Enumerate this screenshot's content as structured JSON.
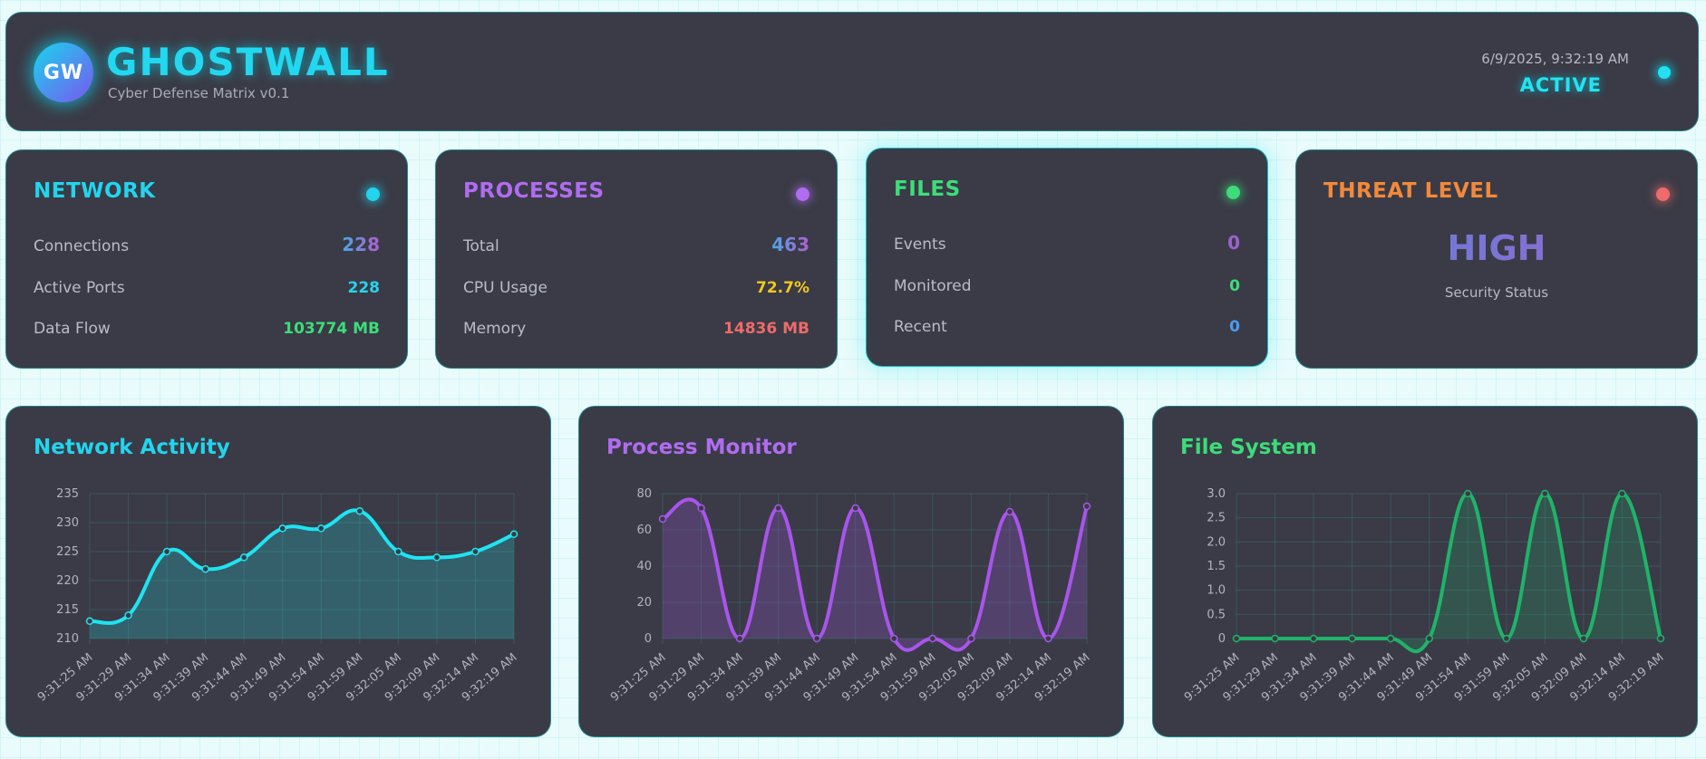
{
  "header": {
    "logo_text": "GW",
    "title": "GHOSTWALL",
    "subtitle": "Cyber Defense Matrix v0.1",
    "datetime": "6/9/2025, 9:32:19 AM",
    "status": "ACTIVE",
    "accent": "#22d8f0"
  },
  "cards": {
    "network": {
      "title": "NETWORK",
      "color": "#22d4ee",
      "rows": [
        {
          "label": "Connections",
          "value": "228"
        },
        {
          "label": "Active Ports",
          "value": "228"
        },
        {
          "label": "Data Flow",
          "value": "103774 MB"
        }
      ]
    },
    "processes": {
      "title": "PROCESSES",
      "color": "#b06cf0",
      "rows": [
        {
          "label": "Total",
          "value": "463"
        },
        {
          "label": "CPU Usage",
          "value": "72.7%"
        },
        {
          "label": "Memory",
          "value": "14836 MB"
        }
      ]
    },
    "files": {
      "title": "FILES",
      "color": "#3ddc7a",
      "rows": [
        {
          "label": "Events",
          "value": "0"
        },
        {
          "label": "Monitored",
          "value": "0"
        },
        {
          "label": "Recent",
          "value": "0"
        }
      ]
    },
    "threat": {
      "title": "THREAT LEVEL",
      "color": "#f2893a",
      "value": "HIGH",
      "subtitle": "Security Status"
    }
  },
  "chart_data": [
    {
      "type": "line",
      "title": "Network Activity",
      "color": "#1ee4f2",
      "x": [
        "9:31:25 AM",
        "9:31:29 AM",
        "9:31:34 AM",
        "9:31:39 AM",
        "9:31:44 AM",
        "9:31:49 AM",
        "9:31:54 AM",
        "9:31:59 AM",
        "9:32:05 AM",
        "9:32:09 AM",
        "9:32:14 AM",
        "9:32:19 AM"
      ],
      "values": [
        213,
        214,
        225,
        222,
        224,
        229,
        229,
        232,
        225,
        224,
        225,
        228
      ],
      "ylim": [
        210,
        235
      ],
      "yticks": [
        "235",
        "230",
        "225",
        "220",
        "215",
        "210"
      ],
      "grid": true
    },
    {
      "type": "line",
      "title": "Process Monitor",
      "color": "#a955ec",
      "x": [
        "9:31:25 AM",
        "9:31:29 AM",
        "9:31:34 AM",
        "9:31:39 AM",
        "9:31:44 AM",
        "9:31:49 AM",
        "9:31:54 AM",
        "9:31:59 AM",
        "9:32:05 AM",
        "9:32:09 AM",
        "9:32:14 AM",
        "9:32:19 AM"
      ],
      "values": [
        66,
        72,
        0,
        72,
        0,
        72,
        0,
        0,
        0,
        70,
        0,
        73
      ],
      "ylim": [
        0,
        80
      ],
      "yticks": [
        "80",
        "60",
        "40",
        "20",
        "0"
      ],
      "grid": true
    },
    {
      "type": "line",
      "title": "File System",
      "color": "#1fb36a",
      "x": [
        "9:31:25 AM",
        "9:31:29 AM",
        "9:31:34 AM",
        "9:31:39 AM",
        "9:31:44 AM",
        "9:31:49 AM",
        "9:31:54 AM",
        "9:31:59 AM",
        "9:32:05 AM",
        "9:32:09 AM",
        "9:32:14 AM",
        "9:32:19 AM"
      ],
      "values": [
        0,
        0,
        0,
        0,
        0,
        0,
        3,
        0,
        3,
        0,
        3,
        0
      ],
      "ylim": [
        0,
        3
      ],
      "yticks": [
        "3.0",
        "2.5",
        "2.0",
        "1.5",
        "1.0",
        "0.5",
        "0"
      ],
      "grid": true
    }
  ]
}
